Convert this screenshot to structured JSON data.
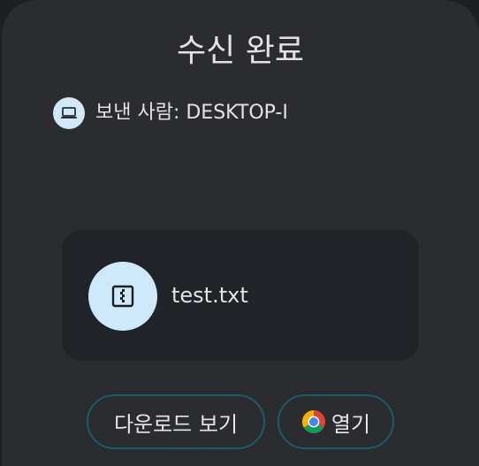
{
  "dialog": {
    "title": "수신 완료",
    "sender_label": "보낸 사람: DESKTOP-I"
  },
  "file": {
    "name": "test.txt"
  },
  "actions": {
    "view_downloads_label": "다운로드 보기",
    "open_label": "열기"
  },
  "icons": {
    "sender_device": "laptop-icon",
    "file": "zip-file-icon",
    "open_app": "chrome-icon"
  },
  "colors": {
    "sheet_bg": "#2b2c2f",
    "card_bg": "#202327",
    "accent_circle": "#cfe9fc",
    "button_border": "#1b5c6c",
    "text": "#e3e3e6"
  }
}
